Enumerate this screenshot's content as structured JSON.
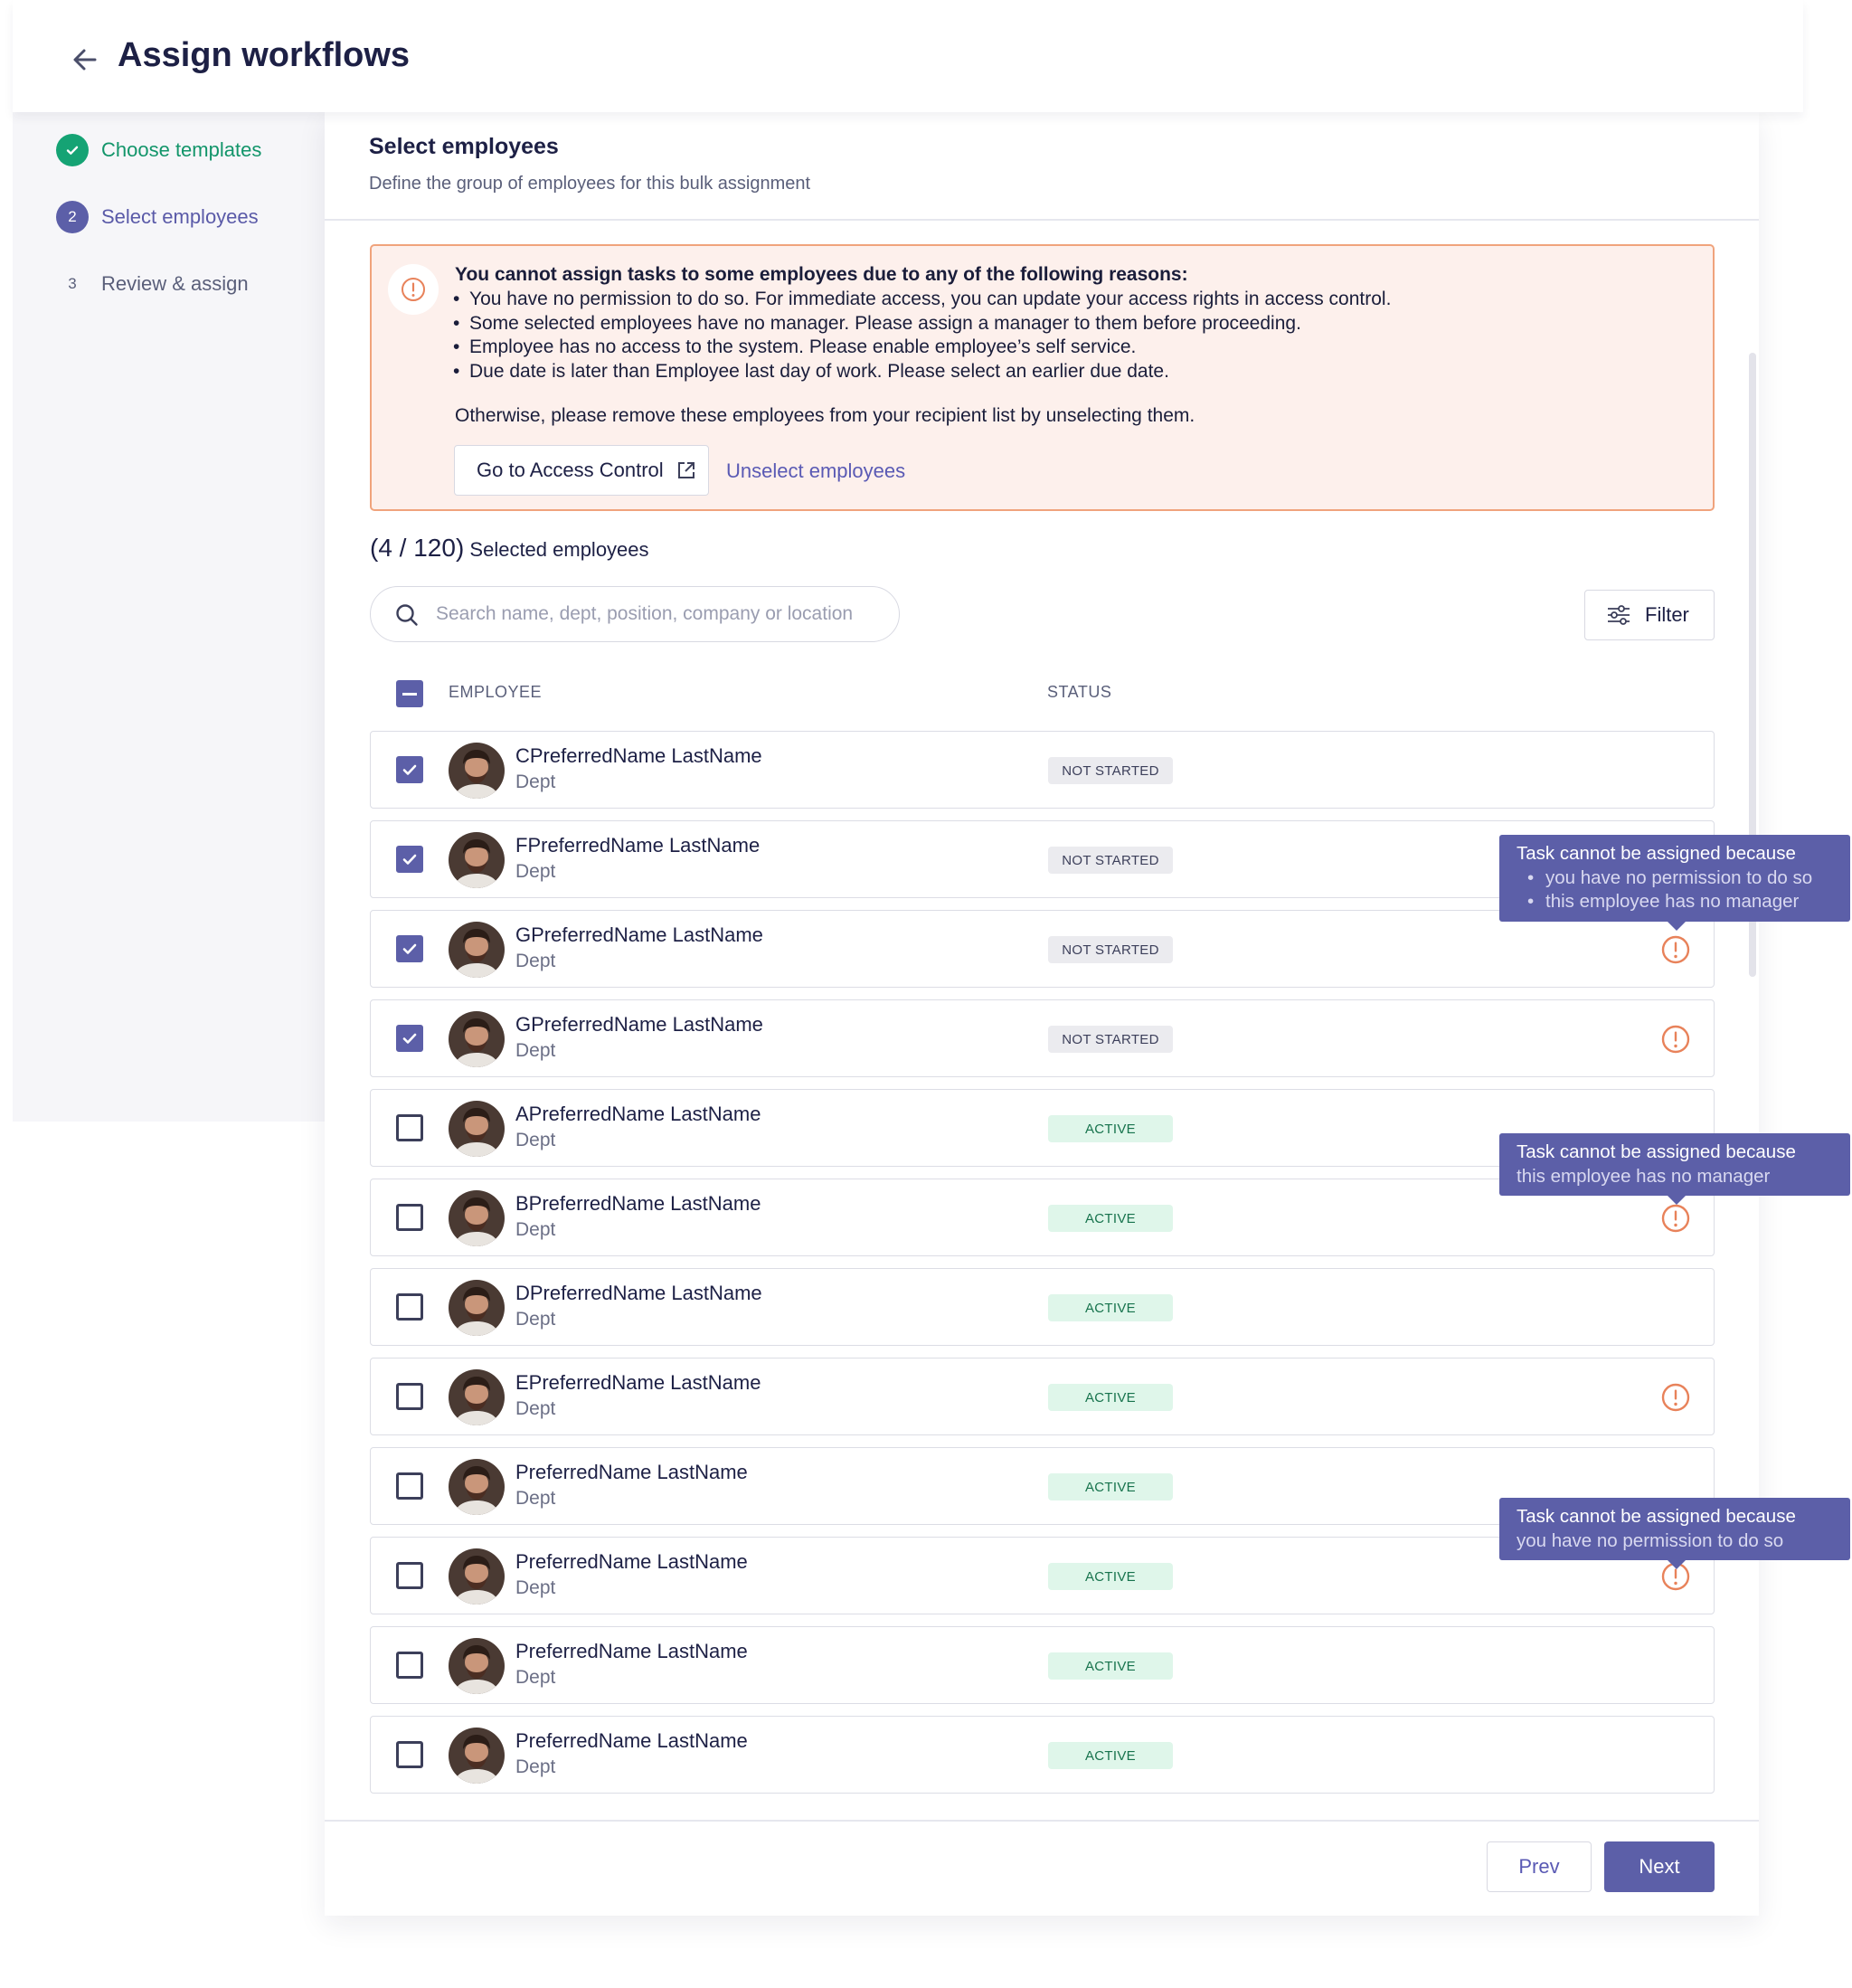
{
  "header": {
    "title": "Assign workflows",
    "back_icon": "arrow-left-icon"
  },
  "steps": [
    {
      "number": "",
      "label": "Choose templates",
      "state": "done"
    },
    {
      "number": "2",
      "label": "Select employees",
      "state": "current"
    },
    {
      "number": "3",
      "label": "Review & assign",
      "state": "todo"
    }
  ],
  "section": {
    "title": "Select employees",
    "subtitle": "Define the group of employees for this bulk assignment"
  },
  "alert": {
    "title": "You cannot assign tasks to some employees due to any of the following reasons:",
    "reasons": [
      "You have no permission to do so. For immediate access, you can update your access rights in access control.",
      "Some selected employees have no manager. Please assign a manager to them before proceeding.",
      "Employee has no access to the system. Please enable employee’s self service.",
      "Due date is later than Employee last day of work. Please select an earlier due date."
    ],
    "otherwise": "Otherwise, please remove these employees from your recipient list by unselecting them.",
    "access_button": "Go to Access Control",
    "unselect_link": "Unselect employees"
  },
  "selection": {
    "count": "(4 / 120)",
    "label": "Selected employees"
  },
  "search": {
    "placeholder": "Search name, dept, position, company or location",
    "value": ""
  },
  "filter_label": "Filter",
  "table": {
    "col_employee": "EMPLOYEE",
    "col_status": "STATUS",
    "rows": [
      {
        "name": "CPreferredName LastName",
        "dept": "Dept",
        "status": "NOT STARTED",
        "checked": true,
        "warning": false
      },
      {
        "name": "FPreferredName LastName",
        "dept": "Dept",
        "status": "NOT STARTED",
        "checked": true,
        "warning": false
      },
      {
        "name": "GPreferredName LastName",
        "dept": "Dept",
        "status": "NOT STARTED",
        "checked": true,
        "warning": true
      },
      {
        "name": "GPreferredName LastName",
        "dept": "Dept",
        "status": "NOT STARTED",
        "checked": true,
        "warning": true
      },
      {
        "name": "APreferredName LastName",
        "dept": "Dept",
        "status": "ACTIVE",
        "checked": false,
        "warning": false
      },
      {
        "name": "BPreferredName LastName",
        "dept": "Dept",
        "status": "ACTIVE",
        "checked": false,
        "warning": true
      },
      {
        "name": "DPreferredName LastName",
        "dept": "Dept",
        "status": "ACTIVE",
        "checked": false,
        "warning": false
      },
      {
        "name": "EPreferredName LastName",
        "dept": "Dept",
        "status": "ACTIVE",
        "checked": false,
        "warning": true
      },
      {
        "name": "PreferredName LastName",
        "dept": "Dept",
        "status": "ACTIVE",
        "checked": false,
        "warning": false
      },
      {
        "name": "PreferredName LastName",
        "dept": "Dept",
        "status": "ACTIVE",
        "checked": false,
        "warning": true
      },
      {
        "name": "PreferredName LastName",
        "dept": "Dept",
        "status": "ACTIVE",
        "checked": false,
        "warning": false
      },
      {
        "name": "PreferredName LastName",
        "dept": "Dept",
        "status": "ACTIVE",
        "checked": false,
        "warning": false
      }
    ]
  },
  "tooltips": [
    {
      "title": "Task cannot be assigned because",
      "reasons": [
        "you have no permission to do so",
        "this employee has no manager"
      ]
    },
    {
      "title": "Task cannot be assigned because",
      "reason": "this employee has no manager"
    },
    {
      "title": "Task cannot be assigned because",
      "reason": "you have no permission to do so"
    }
  ],
  "footer": {
    "prev": "Prev",
    "next": "Next"
  },
  "colors": {
    "primary": "#5c5fa8",
    "success": "#15a374",
    "warning": "#e8825a",
    "alert_bg": "#fdf0ec"
  }
}
